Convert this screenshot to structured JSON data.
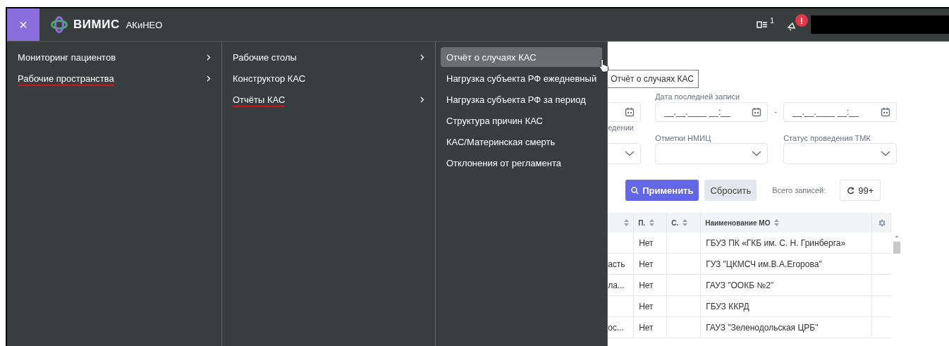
{
  "header": {
    "close": "×",
    "brand": "ВИМИС",
    "product": "АКиНЕО",
    "tasks_count": "1",
    "alert_mark": "!"
  },
  "menu": {
    "columns": [
      {
        "items": [
          {
            "label": "Мониторинг пациентов",
            "has_submenu": true,
            "selected": false,
            "highlighted": false
          },
          {
            "label": "Рабочие пространства",
            "has_submenu": true,
            "selected": true,
            "highlighted": false
          }
        ]
      },
      {
        "items": [
          {
            "label": "Рабочие столы",
            "has_submenu": true,
            "selected": false,
            "highlighted": false
          },
          {
            "label": "Конструктор КАС",
            "has_submenu": false,
            "selected": false,
            "highlighted": false
          },
          {
            "label": "Отчёты КАС",
            "has_submenu": true,
            "selected": true,
            "highlighted": false
          }
        ]
      },
      {
        "items": [
          {
            "label": "Отчёт о случаях КАС",
            "has_submenu": false,
            "selected": false,
            "highlighted": true
          },
          {
            "label": "Нагрузка субъекта РФ ежедневный",
            "has_submenu": false,
            "selected": false,
            "highlighted": false
          },
          {
            "label": "Нагрузка субъекта РФ за период",
            "has_submenu": false,
            "selected": false,
            "highlighted": false
          },
          {
            "label": "Структура причин КАС",
            "has_submenu": false,
            "selected": false,
            "highlighted": false
          },
          {
            "label": "КАС/Материнская смерть",
            "has_submenu": false,
            "selected": false,
            "highlighted": false
          },
          {
            "label": "Отклонения от регламента",
            "has_submenu": false,
            "selected": false,
            "highlighted": false
          }
        ]
      }
    ]
  },
  "tooltip": "Отчёт о случаях КАС",
  "filters": {
    "date_label": "Дата последней записи",
    "date_from": {
      "placeholder": "__.__.____ __:__"
    },
    "separator": "-",
    "date_to": {
      "placeholder": "__.__.____ __:__"
    },
    "cut_label": "едении",
    "selects": [
      {
        "label": "Отметки НМИЦ"
      },
      {
        "label": "Статус проведения ТМК"
      }
    ]
  },
  "actions": {
    "apply": "Применить",
    "reset": "Сбросить",
    "total_label": "Всего записей:",
    "total_count": "99+"
  },
  "table": {
    "columns": [
      {
        "kind": "cut"
      },
      {
        "kind": "text",
        "label": "П."
      },
      {
        "kind": "text",
        "label": "С."
      },
      {
        "kind": "wide",
        "label": "Наименование МО"
      }
    ],
    "rows": [
      {
        "column_2": "Нет",
        "name": "ГБУЗ ПК «ГКБ им. С. Н. Гринберга»"
      },
      {
        "column_1": "асть",
        "column_2": "Нет",
        "name": "ГУЗ \"ЦКМСЧ им.В.А.Егорова\""
      },
      {
        "column_1": "ла...",
        "column_2": "Нет",
        "name": "ГАУЗ \"ООКБ №2\""
      },
      {
        "column_2": "Нет",
        "name": "ГБУЗ ККРД"
      },
      {
        "column_1": "ос...",
        "column_2": "Нет",
        "name": "ГАУЗ \"Зеленодольская ЦРБ\""
      }
    ]
  }
}
